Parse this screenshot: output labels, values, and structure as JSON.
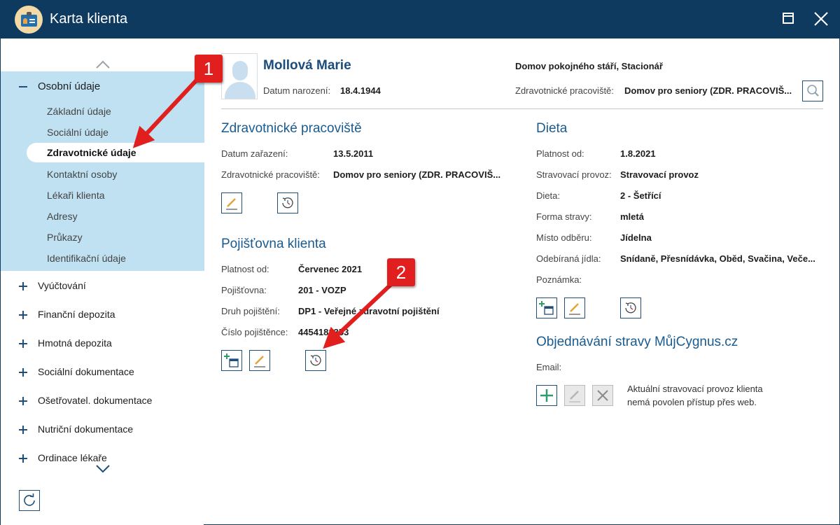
{
  "window": {
    "title": "Karta klienta"
  },
  "sidebar": {
    "group": {
      "label": "Osobní údaje",
      "items": [
        {
          "label": "Základní údaje"
        },
        {
          "label": "Sociální údaje"
        },
        {
          "label": "Zdravotnické údaje",
          "active": true
        },
        {
          "label": "Kontaktní osoby"
        },
        {
          "label": "Lékaři klienta"
        },
        {
          "label": "Adresy"
        },
        {
          "label": "Průkazy"
        },
        {
          "label": "Identifikační údaje"
        }
      ]
    },
    "sections": [
      {
        "label": "Vyúčtování"
      },
      {
        "label": "Finanční depozita"
      },
      {
        "label": "Hmotná depozita"
      },
      {
        "label": "Sociální dokumentace"
      },
      {
        "label": "Ošetřovatel. dokumentace"
      },
      {
        "label": "Nutriční dokumentace"
      },
      {
        "label": "Ordinace lékaře"
      }
    ]
  },
  "client": {
    "name": "Mollová Marie",
    "birth_label": "Datum narození:",
    "birth_value": "18.4.1944",
    "facility": "Domov pokojného stáří, Stacionář",
    "workplace_label": "Zdravotnické pracoviště:",
    "workplace_value": "Domov pro seniory (ZDR. PRACOVIŠ..."
  },
  "health_workplace": {
    "title": "Zdravotnické pracoviště",
    "fields": [
      {
        "label": "Datum zařazení:",
        "value": "13.5.2011"
      },
      {
        "label": "Zdravotnické pracoviště:",
        "value": "Domov pro seniory (ZDR. PRACOVIŠ..."
      }
    ]
  },
  "insurance": {
    "title": "Pojišťovna klienta",
    "fields": [
      {
        "label": "Platnost od:",
        "value": "Červenec 2021"
      },
      {
        "label": "Pojišťovna:",
        "value": "201 - VOZP"
      },
      {
        "label": "Druh pojištění:",
        "value": "DP1 - Veřejné zdravotní pojištění"
      },
      {
        "label": "Číslo pojištěnce:",
        "value": "4454181353"
      }
    ]
  },
  "diet": {
    "title": "Dieta",
    "fields": [
      {
        "label": "Platnost od:",
        "value": "1.8.2021"
      },
      {
        "label": "Stravovací provoz:",
        "value": "Stravovací provoz"
      },
      {
        "label": "Dieta:",
        "value": "2 - Šetřící"
      },
      {
        "label": "Forma stravy:",
        "value": "mletá"
      },
      {
        "label": "Místo odběru:",
        "value": "Jídelna"
      },
      {
        "label": "Odebíraná jídla:",
        "value": "Snídaně, Přesnídávka, Oběd, Svačina, Veče..."
      },
      {
        "label": "Poznámka:",
        "value": ""
      }
    ]
  },
  "ordering": {
    "title": "Objednávání stravy MůjCygnus.cz",
    "email_label": "Email:",
    "note_line1": "Aktuální stravovací provoz klienta",
    "note_line2": "nemá povolen přístup přes web."
  },
  "callouts": {
    "one": "1",
    "two": "2"
  },
  "colors": {
    "titlebar": "#0f3a5f",
    "sidebar_group": "#bfe1f2",
    "section_title": "#1a5b8f",
    "callout": "#e11f1f"
  }
}
